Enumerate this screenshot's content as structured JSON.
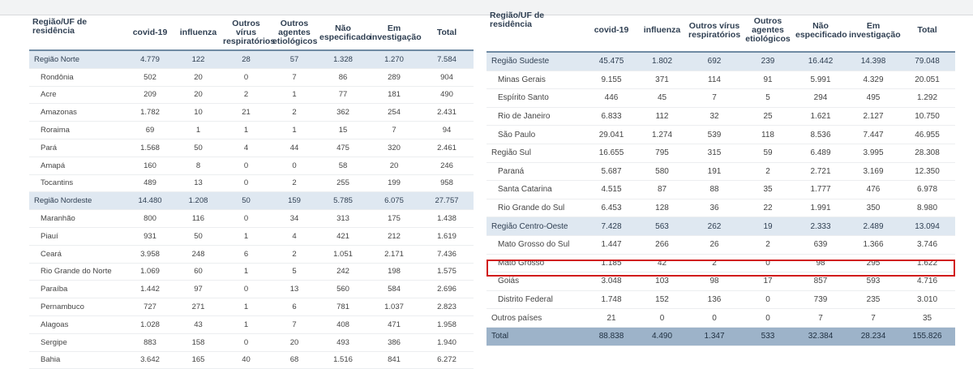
{
  "headers": [
    "Região/UF de residência",
    "covid-19",
    "influenza",
    "Outros vírus respiratórios",
    "Outros agentes etiológicos",
    "Não especificado",
    "Em investigação",
    "Total"
  ],
  "left_rows": [
    {
      "kind": "region",
      "cells": [
        "Região Norte",
        "4.779",
        "122",
        "28",
        "57",
        "1.328",
        "1.270",
        "7.584"
      ]
    },
    {
      "kind": "state",
      "cells": [
        "Rondônia",
        "502",
        "20",
        "0",
        "7",
        "86",
        "289",
        "904"
      ]
    },
    {
      "kind": "state",
      "cells": [
        "Acre",
        "209",
        "20",
        "2",
        "1",
        "77",
        "181",
        "490"
      ]
    },
    {
      "kind": "state",
      "cells": [
        "Amazonas",
        "1.782",
        "10",
        "21",
        "2",
        "362",
        "254",
        "2.431"
      ]
    },
    {
      "kind": "state",
      "cells": [
        "Roraima",
        "69",
        "1",
        "1",
        "1",
        "15",
        "7",
        "94"
      ]
    },
    {
      "kind": "state",
      "cells": [
        "Pará",
        "1.568",
        "50",
        "4",
        "44",
        "475",
        "320",
        "2.461"
      ]
    },
    {
      "kind": "state",
      "cells": [
        "Amapá",
        "160",
        "8",
        "0",
        "0",
        "58",
        "20",
        "246"
      ]
    },
    {
      "kind": "state",
      "cells": [
        "Tocantins",
        "489",
        "13",
        "0",
        "2",
        "255",
        "199",
        "958"
      ]
    },
    {
      "kind": "region",
      "cells": [
        "Região Nordeste",
        "14.480",
        "1.208",
        "50",
        "159",
        "5.785",
        "6.075",
        "27.757"
      ]
    },
    {
      "kind": "state",
      "cells": [
        "Maranhão",
        "800",
        "116",
        "0",
        "34",
        "313",
        "175",
        "1.438"
      ]
    },
    {
      "kind": "state",
      "cells": [
        "Piauí",
        "931",
        "50",
        "1",
        "4",
        "421",
        "212",
        "1.619"
      ]
    },
    {
      "kind": "state",
      "cells": [
        "Ceará",
        "3.958",
        "248",
        "6",
        "2",
        "1.051",
        "2.171",
        "7.436"
      ]
    },
    {
      "kind": "state",
      "cells": [
        "Rio Grande do Norte",
        "1.069",
        "60",
        "1",
        "5",
        "242",
        "198",
        "1.575"
      ]
    },
    {
      "kind": "state",
      "cells": [
        "Paraíba",
        "1.442",
        "97",
        "0",
        "13",
        "560",
        "584",
        "2.696"
      ]
    },
    {
      "kind": "state",
      "cells": [
        "Pernambuco",
        "727",
        "271",
        "1",
        "6",
        "781",
        "1.037",
        "2.823"
      ]
    },
    {
      "kind": "state",
      "cells": [
        "Alagoas",
        "1.028",
        "43",
        "1",
        "7",
        "408",
        "471",
        "1.958"
      ]
    },
    {
      "kind": "state",
      "cells": [
        "Sergipe",
        "883",
        "158",
        "0",
        "20",
        "493",
        "386",
        "1.940"
      ]
    },
    {
      "kind": "state",
      "cells": [
        "Bahia",
        "3.642",
        "165",
        "40",
        "68",
        "1.516",
        "841",
        "6.272"
      ]
    }
  ],
  "right_rows": [
    {
      "kind": "region",
      "cells": [
        "Região Sudeste",
        "45.475",
        "1.802",
        "692",
        "239",
        "16.442",
        "14.398",
        "79.048"
      ]
    },
    {
      "kind": "state",
      "cells": [
        "Minas Gerais",
        "9.155",
        "371",
        "114",
        "91",
        "5.991",
        "4.329",
        "20.051"
      ]
    },
    {
      "kind": "state",
      "cells": [
        "Espírito Santo",
        "446",
        "45",
        "7",
        "5",
        "294",
        "495",
        "1.292"
      ]
    },
    {
      "kind": "state",
      "cells": [
        "Rio de Janeiro",
        "6.833",
        "112",
        "32",
        "25",
        "1.621",
        "2.127",
        "10.750"
      ]
    },
    {
      "kind": "state",
      "cells": [
        "São Paulo",
        "29.041",
        "1.274",
        "539",
        "118",
        "8.536",
        "7.447",
        "46.955"
      ]
    },
    {
      "kind": "region-plain",
      "cells": [
        "Região Sul",
        "16.655",
        "795",
        "315",
        "59",
        "6.489",
        "3.995",
        "28.308"
      ]
    },
    {
      "kind": "state",
      "cells": [
        "Paraná",
        "5.687",
        "580",
        "191",
        "2",
        "2.721",
        "3.169",
        "12.350"
      ]
    },
    {
      "kind": "state",
      "cells": [
        "Santa Catarina",
        "4.515",
        "87",
        "88",
        "35",
        "1.777",
        "476",
        "6.978"
      ]
    },
    {
      "kind": "state",
      "cells": [
        "Rio Grande do Sul",
        "6.453",
        "128",
        "36",
        "22",
        "1.991",
        "350",
        "8.980"
      ]
    },
    {
      "kind": "region",
      "cells": [
        "Região Centro-Oeste",
        "7.428",
        "563",
        "262",
        "19",
        "2.333",
        "2.489",
        "13.094"
      ]
    },
    {
      "kind": "state",
      "cells": [
        "Mato Grosso do Sul",
        "1.447",
        "266",
        "26",
        "2",
        "639",
        "1.366",
        "3.746"
      ]
    },
    {
      "kind": "state",
      "cells": [
        "Mato Grosso",
        "1.185",
        "42",
        "2",
        "0",
        "98",
        "295",
        "1.622"
      ]
    },
    {
      "kind": "state",
      "cells": [
        "Goiás",
        "3.048",
        "103",
        "98",
        "17",
        "857",
        "593",
        "4.716"
      ]
    },
    {
      "kind": "state",
      "cells": [
        "Distrito Federal",
        "1.748",
        "152",
        "136",
        "0",
        "739",
        "235",
        "3.010"
      ]
    },
    {
      "kind": "other",
      "cells": [
        "Outros países",
        "21",
        "0",
        "0",
        "0",
        "7",
        "7",
        "35"
      ]
    },
    {
      "kind": "total",
      "cells": [
        "Total",
        "88.838",
        "4.490",
        "1.347",
        "533",
        "32.384",
        "28.234",
        "155.826"
      ]
    }
  ],
  "highlight_color": "#d11b1b"
}
